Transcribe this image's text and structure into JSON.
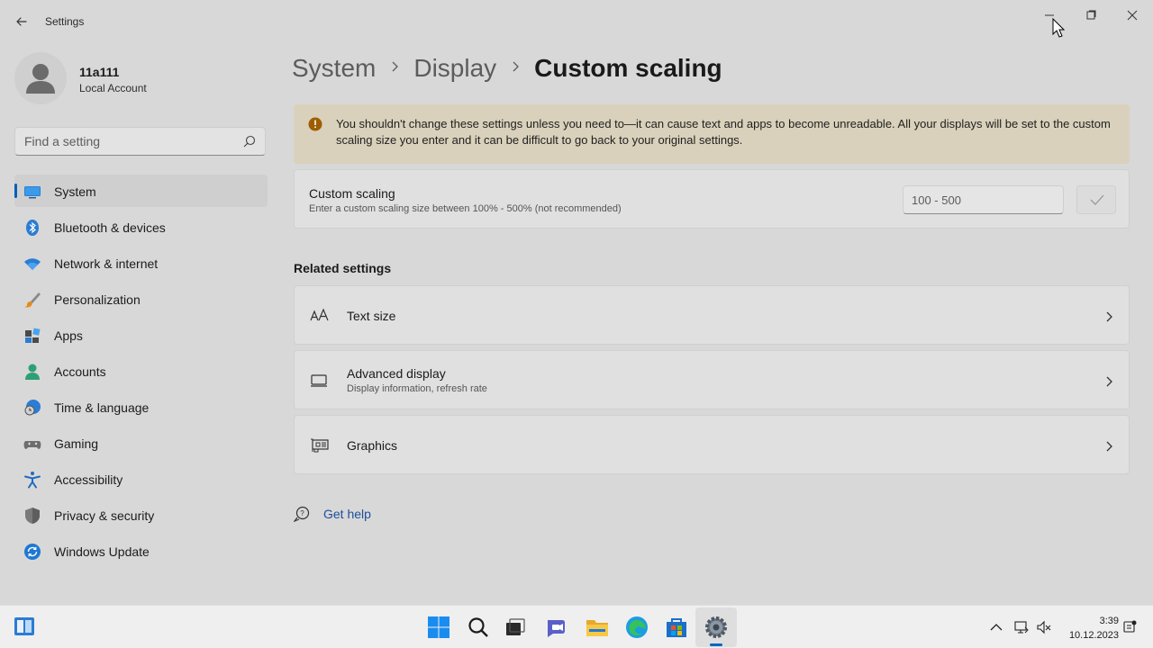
{
  "window": {
    "title": "Settings"
  },
  "profile": {
    "name": "11a111",
    "account_type": "Local Account"
  },
  "search": {
    "placeholder": "Find a setting"
  },
  "sidebar": {
    "items": [
      {
        "label": "System",
        "icon": "system-icon",
        "selected": true
      },
      {
        "label": "Bluetooth & devices",
        "icon": "bluetooth-icon"
      },
      {
        "label": "Network & internet",
        "icon": "wifi-icon"
      },
      {
        "label": "Personalization",
        "icon": "brush-icon"
      },
      {
        "label": "Apps",
        "icon": "apps-icon"
      },
      {
        "label": "Accounts",
        "icon": "accounts-icon"
      },
      {
        "label": "Time & language",
        "icon": "clock-globe-icon"
      },
      {
        "label": "Gaming",
        "icon": "gamepad-icon"
      },
      {
        "label": "Accessibility",
        "icon": "accessibility-icon"
      },
      {
        "label": "Privacy & security",
        "icon": "shield-icon"
      },
      {
        "label": "Windows Update",
        "icon": "update-icon"
      }
    ]
  },
  "breadcrumb": {
    "items": [
      "System",
      "Display",
      "Custom scaling"
    ]
  },
  "warning": {
    "text": "You shouldn't change these settings unless you need to—it can cause text and apps to become unreadable. All your displays will be set to the custom scaling size you enter and it can be difficult to go back to your original settings."
  },
  "custom_scaling": {
    "title": "Custom scaling",
    "subtitle": "Enter a custom scaling size between 100% - 500% (not recommended)",
    "placeholder": "100 - 500"
  },
  "related": {
    "title": "Related settings",
    "items": [
      {
        "title": "Text size",
        "subtitle": ""
      },
      {
        "title": "Advanced display",
        "subtitle": "Display information, refresh rate"
      },
      {
        "title": "Graphics",
        "subtitle": ""
      }
    ]
  },
  "help": {
    "label": "Get help"
  },
  "taskbar": {
    "time": "3:39",
    "date": "10.12.2023"
  },
  "colors": {
    "accent": "#005fb8",
    "warning_bg": "#d9d1bb",
    "link": "#1c4f9a"
  }
}
